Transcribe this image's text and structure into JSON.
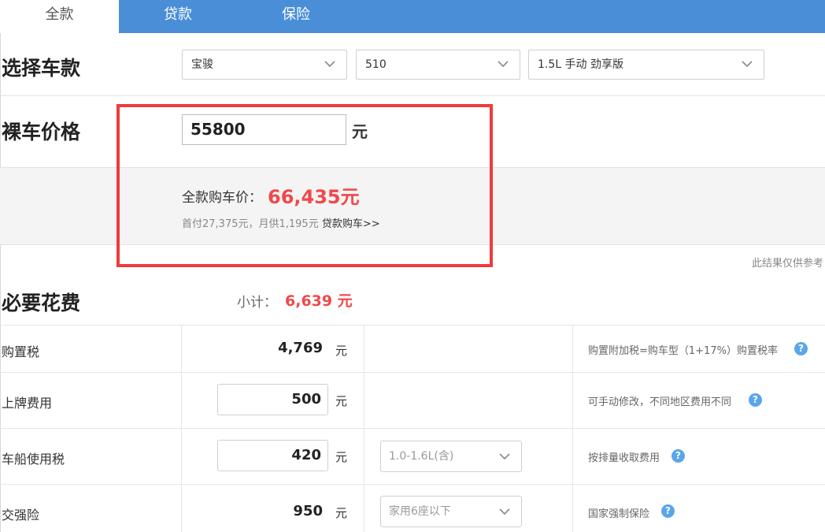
{
  "tabs": [
    {
      "label": "全款"
    },
    {
      "label": "贷款"
    },
    {
      "label": "保险"
    }
  ],
  "select_car": {
    "title": "选择车款",
    "brand": "宝骏",
    "model": "510",
    "version": "1.5L 手动 劲享版"
  },
  "bare_price": {
    "title": "裸车价格",
    "value": "55800",
    "unit": "元"
  },
  "summary": {
    "label": "全款购车价：",
    "value": "66,435元",
    "sub_text": "首付27,375元，月供1,195元",
    "loan_link": "贷款购车>>",
    "note": "此结果仅供参考"
  },
  "required": {
    "title": "必要花费",
    "subtotal_label": "小计：",
    "subtotal_value": "6,639 元"
  },
  "cost_rows": [
    {
      "label": "购置税",
      "value": "4,769",
      "unit": "元",
      "hint": "购置附加税=购车型（1+17%）购置税率"
    },
    {
      "label": "上牌费用",
      "value": "500",
      "unit": "元",
      "hint": "可手动修改，不同地区费用不同"
    },
    {
      "label": "车船使用税",
      "value": "420",
      "unit": "元",
      "option": "1.0-1.6L(含)",
      "hint": "按排量收取费用"
    },
    {
      "label": "交强险",
      "value": "950",
      "unit": "元",
      "option": "家用6座以下",
      "hint": "国家强制保险"
    }
  ],
  "colors": {
    "tab_bar": "#4a8ed8",
    "highlight_red": "#f0484a",
    "frame_red": "#ee3b3b",
    "help_blue": "#5aa6ea"
  },
  "icons": {
    "dropdown": "chevron-down-icon",
    "help": "help-icon"
  }
}
